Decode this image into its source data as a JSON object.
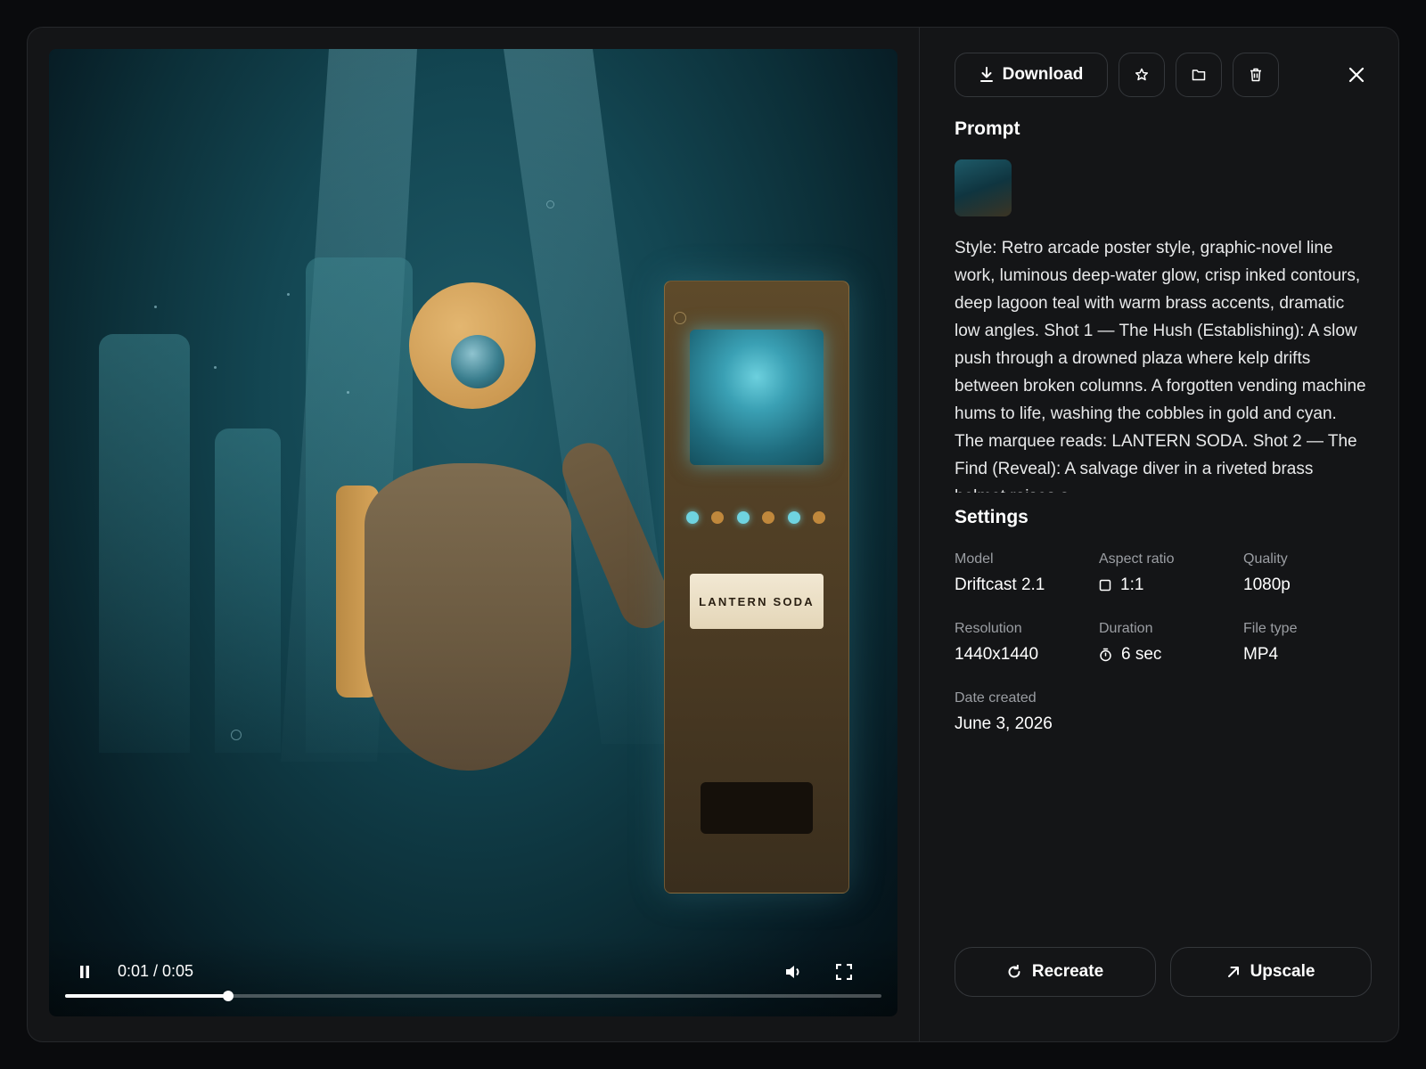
{
  "video": {
    "time_display": "0:01 / 0:05",
    "progress": 0.2,
    "marquee_text": "LANTERN SODA"
  },
  "toolbar": {
    "download_label": "Download",
    "favorite_icon": "star-icon",
    "folder_icon": "folder-icon",
    "delete_icon": "trash-icon",
    "close_icon": "close-icon"
  },
  "prompt": {
    "title": "Prompt",
    "text": "Style: Retro arcade poster style, graphic-novel line work, luminous deep-water glow, crisp inked contours, deep lagoon teal with warm brass accents, dramatic low angles. Shot 1 — The Hush (Establishing): A slow push through a drowned plaza where kelp drifts between broken columns. A forgotten vending machine hums to life, washing the cobbles in gold and cyan. The marquee reads: LANTERN SODA. Shot 2 — The Find (Reveal): A salvage diver in a riveted brass helmet raises a"
  },
  "settings": {
    "title": "Settings",
    "model_label": "Model",
    "model_value": "Driftcast 2.1",
    "aspect_label": "Aspect ratio",
    "aspect_value": "1:1",
    "quality_label": "Quality",
    "quality_value": "1080p",
    "resolution_label": "Resolution",
    "resolution_value": "1440x1440",
    "duration_label": "Duration",
    "duration_value": "6 sec",
    "filetype_label": "File type",
    "filetype_value": "MP4",
    "date_label": "Date created",
    "date_value": "June 3, 2026"
  },
  "actions": {
    "recreate_label": "Recreate",
    "upscale_label": "Upscale"
  },
  "colors": {
    "panel_bg": "#141517",
    "border": "#34373b",
    "muted_text": "#9b9ea3",
    "teal": "#134652",
    "brass": "#c48f47"
  }
}
